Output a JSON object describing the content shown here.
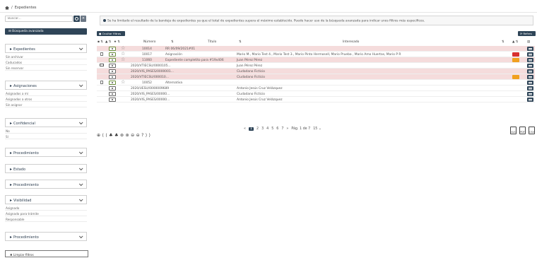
{
  "breadcrumb": {
    "current": "Expedientes"
  },
  "sidebar": {
    "search_placeholder": "Buscar...",
    "clear_search": "×",
    "advanced_search": "⊟ Búsqueda avanzada",
    "groups": [
      {
        "title": "Expedientes",
        "items": [
          "Sin archivar",
          "Caducados",
          "Sin reservar"
        ]
      },
      {
        "title": "Asignaciones",
        "items": [
          "Asignados a mí",
          "Asignados a otros",
          "Sin asignar"
        ]
      },
      {
        "title": "Confidencial",
        "items": [
          "No",
          "Sí"
        ]
      },
      {
        "title": "Procedimiento",
        "items": []
      },
      {
        "title": "Estado",
        "items": []
      },
      {
        "title": "Procedimiento",
        "items": []
      },
      {
        "title": "Visibilidad",
        "items": [
          "Asignado",
          "Asignado para trámite",
          "Responsable"
        ]
      },
      {
        "title": "Procedimiento",
        "items": []
      }
    ],
    "clean_filters": "✖ Limpiar filtros"
  },
  "notice": "Se ha limitado el resultado de la bandeja de expedientes ya que el total de expedientes supera el máximo establecido. Puede hacer uso de la búsqueda avanzada para indicar unos filtros más específicos.",
  "toolbar": {
    "hide_filters": "● Ocultar filtros ▼",
    "refresh": "⟳ Refres (18)"
  },
  "table": {
    "headers": {
      "numero": "Número",
      "titulo": "Título",
      "interesado": "Interesado"
    },
    "rows": [
      {
        "numero": "10014",
        "titulo": "RR 06/09/2021#01",
        "interesado": "",
        "badge": ""
      },
      {
        "numero": "10017",
        "titulo": "Asignación",
        "interesado": "Mario M., Mario Test 4., Mario Test 3., Mario Pinto Hermosell, Mario Prueba , Mario Amo Huertas, Mario P R",
        "badge": "red"
      },
      {
        "numero": "11060",
        "titulo": "Expediente completito para #19x406",
        "interesado": "Juan Pérez Pérez",
        "badge": "orange"
      },
      {
        "numero": "2020/VTIECSU/0000105...",
        "titulo": "",
        "interesado": "Juan Pérez Pérez",
        "badge": ""
      },
      {
        "numero": "2020/VIS_PASES/0000001...",
        "titulo": "",
        "interesado": "Ciudadano Ficticio",
        "badge": ""
      },
      {
        "numero": "2020/VTIECSU/000010...",
        "titulo": "",
        "interesado": "Ciudadano Ficticio",
        "badge": "orange"
      },
      {
        "numero": "10052",
        "titulo": "Alternativa",
        "interesado": "",
        "badge": ""
      },
      {
        "numero": "2020/UESU/0000009689",
        "titulo": "",
        "interesado": "Antonio Jesús Cruz Velázquez",
        "badge": ""
      },
      {
        "numero": "2020/VIS_PASES/00000...",
        "titulo": "",
        "interesado": "Ciudadano Ficticio",
        "badge": ""
      },
      {
        "numero": "2020/VIS_PASES/00000...",
        "titulo": "",
        "interesado": "Antonio Jesús Cruz Velázquez",
        "badge": ""
      }
    ]
  },
  "pager": {
    "first": "«",
    "pages": [
      "1",
      "2",
      "3",
      "4",
      "5",
      "6",
      "7"
    ],
    "last": "»",
    "summary": "Pág. 1 de 7",
    "per_page": "15 ⌄"
  },
  "bulk_tools": "⊕ ⟨ ⟨ ♣ ♣ ⊛ ⊛ ⊖ ⊖ ? ⟩ ⟩",
  "exports": [
    "XLS",
    "PDF",
    "CSV"
  ],
  "colors": {
    "primary": "#2f4558",
    "row_pink": "#f5dcdc",
    "badge_orange": "#f0a020",
    "badge_red": "#d83030"
  }
}
